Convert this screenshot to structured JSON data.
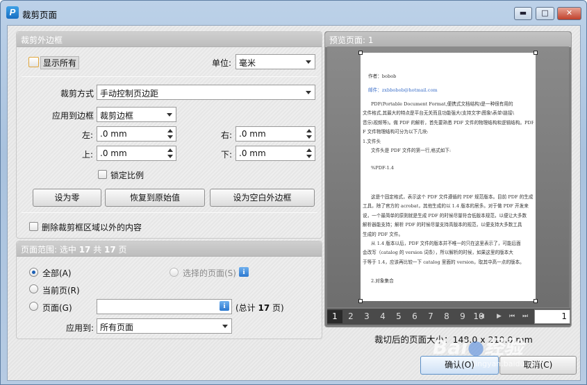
{
  "window": {
    "title": "裁剪页面",
    "min_glyph": "▬",
    "max_glyph": "□",
    "close_glyph": "✕"
  },
  "crop_margins": {
    "header": "裁剪外边框",
    "show_all_label": "显示所有",
    "unit_label": "单位:",
    "unit_value": "毫米",
    "crop_method_label": "裁剪方式",
    "crop_method_value": "手动控制页边距",
    "apply_to_box_label": "应用到边框",
    "apply_to_box_value": "裁剪边框",
    "left_label": "左:",
    "left_value": ".0 mm",
    "right_label": "右:",
    "right_value": ".0 mm",
    "top_label": "上:",
    "top_value": ".0 mm",
    "bottom_label": "下:",
    "bottom_value": ".0 mm",
    "lock_ratio_label": "锁定比例",
    "set_zero_button": "设为零",
    "restore_button": "恢复到原始值",
    "set_white_margin_button": "设为空白外边框",
    "delete_outside_label": "删除裁剪框区域以外的内容"
  },
  "page_range": {
    "header_prefix": "页面范围: 选中 ",
    "selected_count": "17",
    "header_middle": " 共 ",
    "total_count": "17",
    "header_suffix": " 页",
    "all_label": "全部(A)",
    "selected_pages_label": "选择的页面(S)",
    "current_page_label": "当前页(R)",
    "pages_label": "页面(G)",
    "pages_input_value": "",
    "total_prefix": "(总计 ",
    "total_pages": "17",
    "total_suffix": " 页)",
    "apply_to_label": "应用到:",
    "apply_to_value": "所有页面"
  },
  "preview": {
    "header": "预览页面: 1",
    "page_lines": [
      {
        "text": "作者：bobob",
        "link": false,
        "indent": 8
      },
      {
        "text": "",
        "link": false,
        "indent": 0
      },
      {
        "text": "邮件：zxbbobob@hotmail.com",
        "link": true,
        "indent": 8
      },
      {
        "text": "",
        "link": false,
        "indent": 0
      },
      {
        "text": "PDF(Portable   Document   Format,便携式文档结构)是一种很有用的",
        "link": false,
        "indent": 12
      },
      {
        "text": "文件格式,其最大的特点是平台无关而且功能强大(支持文字\\图象\\表单\\链接\\",
        "link": false,
        "indent": 0
      },
      {
        "text": "音乐\\视频等)。做 PDF 的解析，首先要熟悉 PDF 文件的物理结构和逻辑结构。PDF",
        "link": false,
        "indent": 0
      },
      {
        "text": "F 文件物理结构可分为以下几块:",
        "link": false,
        "indent": 0
      },
      {
        "text": "1.文件头",
        "link": false,
        "indent": 0
      },
      {
        "text": "文件头是 PDF 文件的第一行,格式如下:",
        "link": false,
        "indent": 12
      },
      {
        "text": "",
        "link": false,
        "indent": 0
      },
      {
        "text": "%PDF-1.4",
        "link": false,
        "indent": 12
      },
      {
        "text": "",
        "link": false,
        "indent": 0
      },
      {
        "text": "",
        "link": false,
        "indent": 0
      },
      {
        "text": "这是个固定格式，表示这个 PDF 文件遵循的 PDF 规范版本。目前 PDF 的生成",
        "link": false,
        "indent": 12
      },
      {
        "text": "工具，除了官方的 acrobat，其他生成的以 1.4 版本的居多。对于做 PDF 开发来",
        "link": false,
        "indent": 0
      },
      {
        "text": "说，一个最简单的原则就是生成 PDF 的时候尽量符合低版本规范，以便让大多数",
        "link": false,
        "indent": 0
      },
      {
        "text": "解析器能支持；解析 PDF 的时候尽量支持高版本的规范，以便支持大多数工具",
        "link": false,
        "indent": 0
      },
      {
        "text": "生成的 PDF 文件。",
        "link": false,
        "indent": 0
      },
      {
        "text": "从 1.4 版本以后，PDF 文件的版本并不唯一的只在这里表示了，可能后面",
        "link": false,
        "indent": 12
      },
      {
        "text": "会改写（catalog 的 version 词条），所以解析的时候，如果这里的版本大",
        "link": false,
        "indent": 0
      },
      {
        "text": "于等于 1.4，应该再比较一下 catalog 里面的 version，取其中高一点的版本。",
        "link": false,
        "indent": 0
      },
      {
        "text": "",
        "link": false,
        "indent": 0
      },
      {
        "text": "2.对象集合",
        "link": false,
        "indent": 12
      }
    ],
    "pages": [
      "1",
      "2",
      "3",
      "4",
      "5",
      "6",
      "7",
      "8",
      "9",
      "10"
    ],
    "current_page": "1",
    "page_input_value": "1",
    "cropped_size_label": "裁切后的页面大小：148.0 x 210.0 mm"
  },
  "footer": {
    "ok_button": "确认(O)",
    "cancel_button": "取消(C)"
  },
  "watermark": {
    "brand": "Bai",
    "brand2": "经验",
    "url": "jingyan.baidu.com"
  },
  "icons": {
    "app_logo": "P",
    "info_icon": "i"
  },
  "colors": {
    "accent": "#1b5fb5",
    "panel_header": "#c4c4c4",
    "preview_bg": "#7c7c7c",
    "pager_bg": "#4a4a4a"
  }
}
